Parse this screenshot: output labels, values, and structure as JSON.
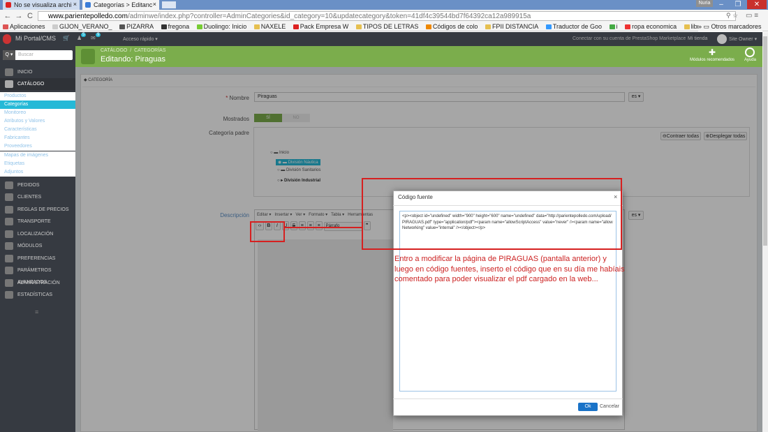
{
  "browser": {
    "tabs": [
      {
        "label": "No se visualiza archi",
        "close": "×"
      },
      {
        "label": "Categorías > Editanc",
        "close": "×"
      }
    ],
    "user": "Nuria",
    "url_host": "www.parientepolledo.com",
    "url_path": "/adminwe/index.php?controller=AdminCategories&id_category=10&updatecategory&token=41df4c39544bd7f64392ca12a989915a",
    "bookmarks": [
      "Aplicaciones",
      "GIJON_VERANO_",
      "PIZARRA",
      "fregona",
      "Duolingo: Inicio",
      "NAXELE",
      "Pack Empresa W",
      "TIPOS DE LETRAS",
      "Códigos de colo",
      "FPII DISTANCIA",
      "Traductor de Goo",
      "i",
      "ropa economica",
      "libro"
    ],
    "bookmarks_more": "»",
    "other_bookmarks": "Otros marcadores"
  },
  "ps": {
    "brand": "Mi Portal/CMS",
    "badge1": "5",
    "badge2": "9",
    "quick_access": "Acceso rápido ▾",
    "connect": "Conectar con su cuenta de PrestaShop Marketplace",
    "store": "Mi tienda",
    "owner": "Site Owner ▾",
    "breadcrumb1": "CATÁLOGO",
    "breadcrumb2": "CATEGORÍAS",
    "page_title": "Editando: Piraguas",
    "modules_label": "Módulos recomendados",
    "help_label": "Ayuda",
    "search_placeholder": "Buscar",
    "search_btn": "Q ▾"
  },
  "sidebar": {
    "inicio": "INICIO",
    "catalogo": "CATÁLOGO",
    "sub": [
      "Productos",
      "Categorías",
      "Monitoreo",
      "Atributos y Valores",
      "Características",
      "Fabricantes",
      "Proveedores",
      "Mapas de imágenes",
      "Etiquetas",
      "Adjuntos"
    ],
    "items": [
      "PEDIDOS",
      "CLIENTES",
      "REGLAS DE PRECIOS",
      "TRANSPORTE",
      "LOCALIZACIÓN",
      "MÓDULOS",
      "PREFERENCIAS",
      "PARÁMETROS AVANZADOS",
      "ADMINISTRACIÓN",
      "ESTADÍSTICAS"
    ],
    "collapse": "≡"
  },
  "form": {
    "section": "CATEGORÍA",
    "name_label": "Nombre",
    "name_value": "Piraguas",
    "lang": "es ▾",
    "shown_label": "Mostrados",
    "yes": "SÍ",
    "no": "NO",
    "parent_label": "Categoría padre",
    "collapse_all": "Contraer todas",
    "expand_all": "Desplegar todas",
    "tree": [
      "Inicio",
      "División Náutica",
      "División Sanitarios",
      "División Industrial"
    ],
    "desc_label": "Descripción",
    "menu": [
      "Editar ▾",
      "Insertar ▾",
      "Ver ▾",
      "Formato ▾",
      "Tabla ▾",
      "Herramientas"
    ],
    "paragraph": "Párrafo"
  },
  "modal": {
    "title": "Código fuente",
    "close": "×",
    "code": "<p><object id=\"undefined\" width=\"900\" height=\"600\" name=\"undefined\" data=\"http://parientepolledo.com/upload/PIRAGUAS.pdf\" type=\"application/pdf\"><param name=\"allowScriptAccess\" value=\"never\" /><param name=\"allowNetworking\" value=\"internal\" /></object></p>",
    "ok": "Ok",
    "cancel": "Cancelar"
  },
  "annotation": "Entro a modificar la página de PIRAGUAS (pantalla anterior) y luego en código fuentes, inserto el código que en su día me habíais comentado para poder visualizar el pdf cargado en la web...",
  "colors": {
    "accent": "#7bad4c",
    "annotation": "#cc2222",
    "sidebar": "#363a41",
    "active": "#25b9d7"
  }
}
